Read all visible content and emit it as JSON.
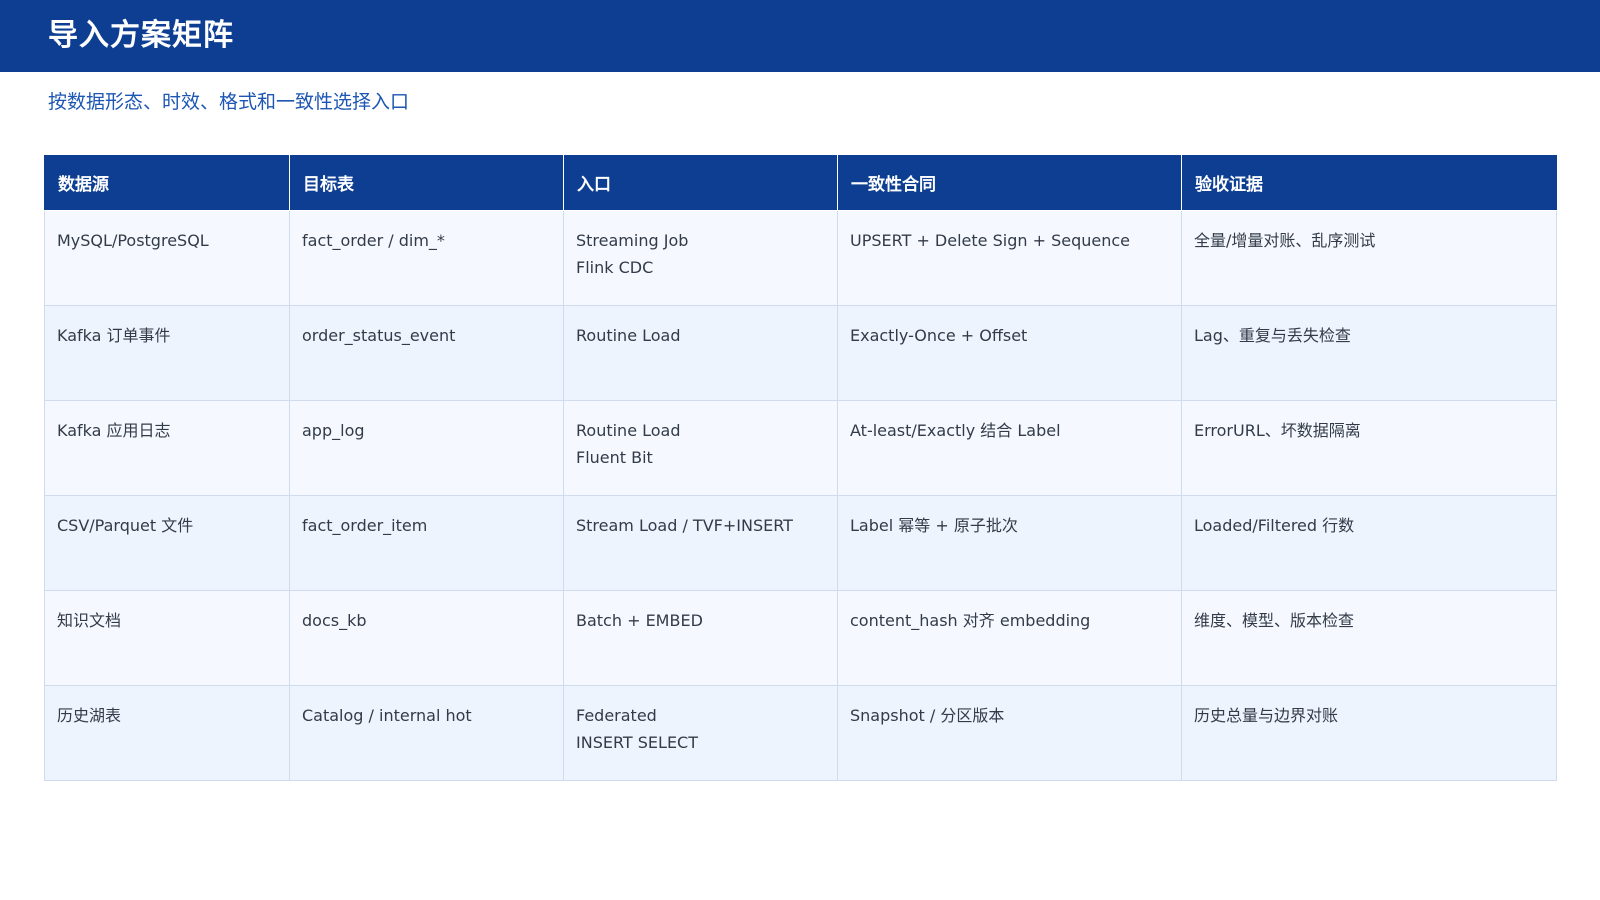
{
  "header": {
    "title": "导入方案矩阵",
    "subtitle": "按数据形态、时效、格式和一致性选择入口"
  },
  "colors": {
    "header_bg": "#0d3e92",
    "subtitle": "#1d56b3",
    "row_odd": "#f5f9ff",
    "row_even": "#edf4fe",
    "grid": "#cfdcee"
  },
  "table": {
    "columns": [
      "数据源",
      "目标表",
      "入口",
      "一致性合同",
      "验收证据"
    ],
    "rows": [
      {
        "source": "MySQL/PostgreSQL",
        "target": "fact_order / dim_*",
        "entry": [
          "Streaming Job",
          "Flink CDC"
        ],
        "contract": "UPSERT + Delete Sign + Sequence",
        "evidence": "全量/增量对账、乱序测试"
      },
      {
        "source": "Kafka 订单事件",
        "target": "order_status_event",
        "entry": [
          "Routine Load"
        ],
        "contract": "Exactly-Once + Offset",
        "evidence": "Lag、重复与丢失检查"
      },
      {
        "source": "Kafka 应用日志",
        "target": "app_log",
        "entry": [
          "Routine Load",
          "Fluent Bit"
        ],
        "contract": "At-least/Exactly 结合 Label",
        "evidence": "ErrorURL、坏数据隔离"
      },
      {
        "source": "CSV/Parquet 文件",
        "target": "fact_order_item",
        "entry": [
          "Stream Load / TVF+INSERT"
        ],
        "contract": "Label 幂等 + 原子批次",
        "evidence": "Loaded/Filtered 行数"
      },
      {
        "source": "知识文档",
        "target": "docs_kb",
        "entry": [
          "Batch + EMBED"
        ],
        "contract": "content_hash 对齐 embedding",
        "evidence": "维度、模型、版本检查"
      },
      {
        "source": "历史湖表",
        "target": "Catalog / internal hot",
        "entry": [
          "Federated",
          "INSERT SELECT"
        ],
        "contract": "Snapshot / 分区版本",
        "evidence": "历史总量与边界对账"
      }
    ]
  }
}
